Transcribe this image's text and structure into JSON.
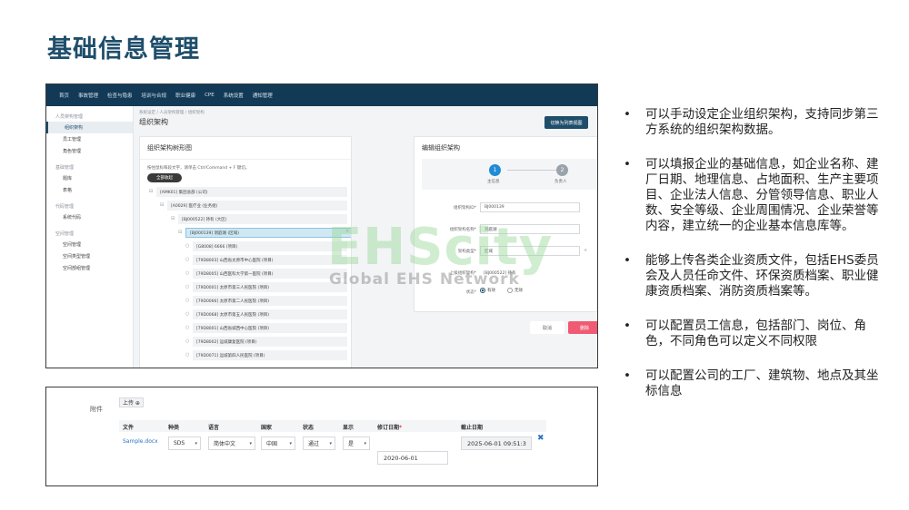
{
  "slide": {
    "title": "基础信息管理"
  },
  "app": {
    "nav": [
      "首页",
      "事故管理",
      "检查与隐患",
      "培训与合规",
      "职业健康",
      "CPE",
      "系统设置",
      "通知管理"
    ],
    "sidebar": {
      "groups": [
        {
          "title": "人员架构管理",
          "items": [
            "组织架构",
            "员工管理",
            "角色管理"
          ]
        },
        {
          "title": "基础管理",
          "items": [
            "题库",
            "表格"
          ]
        },
        {
          "title": "代码管理",
          "items": [
            "系统代码"
          ]
        },
        {
          "title": "空间管理",
          "items": [
            "空间管理",
            "空间类型管理",
            "空间部组管理"
          ]
        }
      ],
      "active": "组织架构"
    },
    "breadcrumb": "系统设定 / 人员架构管理 / 组织架构",
    "page_title": "组织架构",
    "switch_button": "切换为列表视图",
    "tree": {
      "title": "组织架构树形图",
      "hint": "按住鼠标每段文字，请单击 Ctrl/Command + F 键切。",
      "expand_all": "全部收起",
      "nodes": [
        "[AMK01] 集团总部 (公司)",
        "[A0029] 医疗业 (业务组)",
        "[BJ000522] 持有 (大区)",
        "[BJ000139] 洞庭湖 (区域)",
        "[G8008] 6666 (项目)",
        "[79D8003] 山西省太原市中心医院 (项目)",
        "[79D8005] 山西医科大学第一医院 (项目)",
        "[79D0001] 太原市第三人民医院 (项目)",
        "[79D0066] 太原市第二人民医院 (项目)",
        "[79D0068] 太原市第五人民医院 (项目)",
        "[79D8001] 山西省城西中心医院 (项目)",
        "[79D8002] 运城康复医院 (项目)",
        "[79D0071] 运城第四人民医院 (项目)"
      ]
    },
    "edit": {
      "title": "编辑组织架构",
      "steps": [
        {
          "num": "1",
          "label": "主信息"
        },
        {
          "num": "2",
          "label": "负责人"
        }
      ],
      "fields": [
        {
          "label": "组织架构ID*",
          "value": "BJ000139"
        },
        {
          "label": "组织架构名称*",
          "value": "洞庭湖"
        },
        {
          "label": "架构类型*",
          "value": "区域"
        },
        {
          "label": "上级组织架构*",
          "value": "[BJ000522] 持有"
        }
      ],
      "status_label": "状态*",
      "status_options": [
        "有效",
        "无效"
      ],
      "status_selected": "有效"
    },
    "actions": {
      "cancel": "取消",
      "delete": "删除",
      "save": "保存"
    }
  },
  "watermark": {
    "big": "EHScity",
    "small": "Global EHS Network"
  },
  "attachment": {
    "label": "附件",
    "upload": "上传 ⊕",
    "columns": [
      "文件",
      "种类",
      "语言",
      "国家",
      "状态",
      "显示",
      "修订日期",
      "截止日期"
    ],
    "required_col": "修订日期",
    "row": {
      "file": "Sample.docx",
      "type": "SDS",
      "language": "简体中文",
      "country": "中国",
      "status": "通过",
      "display": "是",
      "revision_date": "2020-06-01",
      "expiry_date": "2025-06-01 09:51:3"
    }
  },
  "bullets": [
    "可以手动设定企业组织架构，支持同步第三方系统的组织架构数据。",
    "可以填报企业的基础信息，如企业名称、建厂日期、地理信息、占地面积、生产主要项目、企业法人信息、分管领导信息、职业人数、安全等级、企业周围情况、企业荣誉等内容，建立统一的企业基本信息库等。",
    "能够上传各类企业资质文件，包括EHS委员会及人员任命文件、环保资质档案、职业健康资质档案、消防资质档案等。",
    "可以配置员工信息，包括部门、岗位、角色，不同角色可以定义不同权限",
    "可以配置公司的工厂、建筑物、地点及其坐标信息"
  ],
  "colors": {
    "title": "#1f4e6b",
    "topnav": "#123a57",
    "primary": "#1f8cd4",
    "danger": "#f05a73"
  }
}
